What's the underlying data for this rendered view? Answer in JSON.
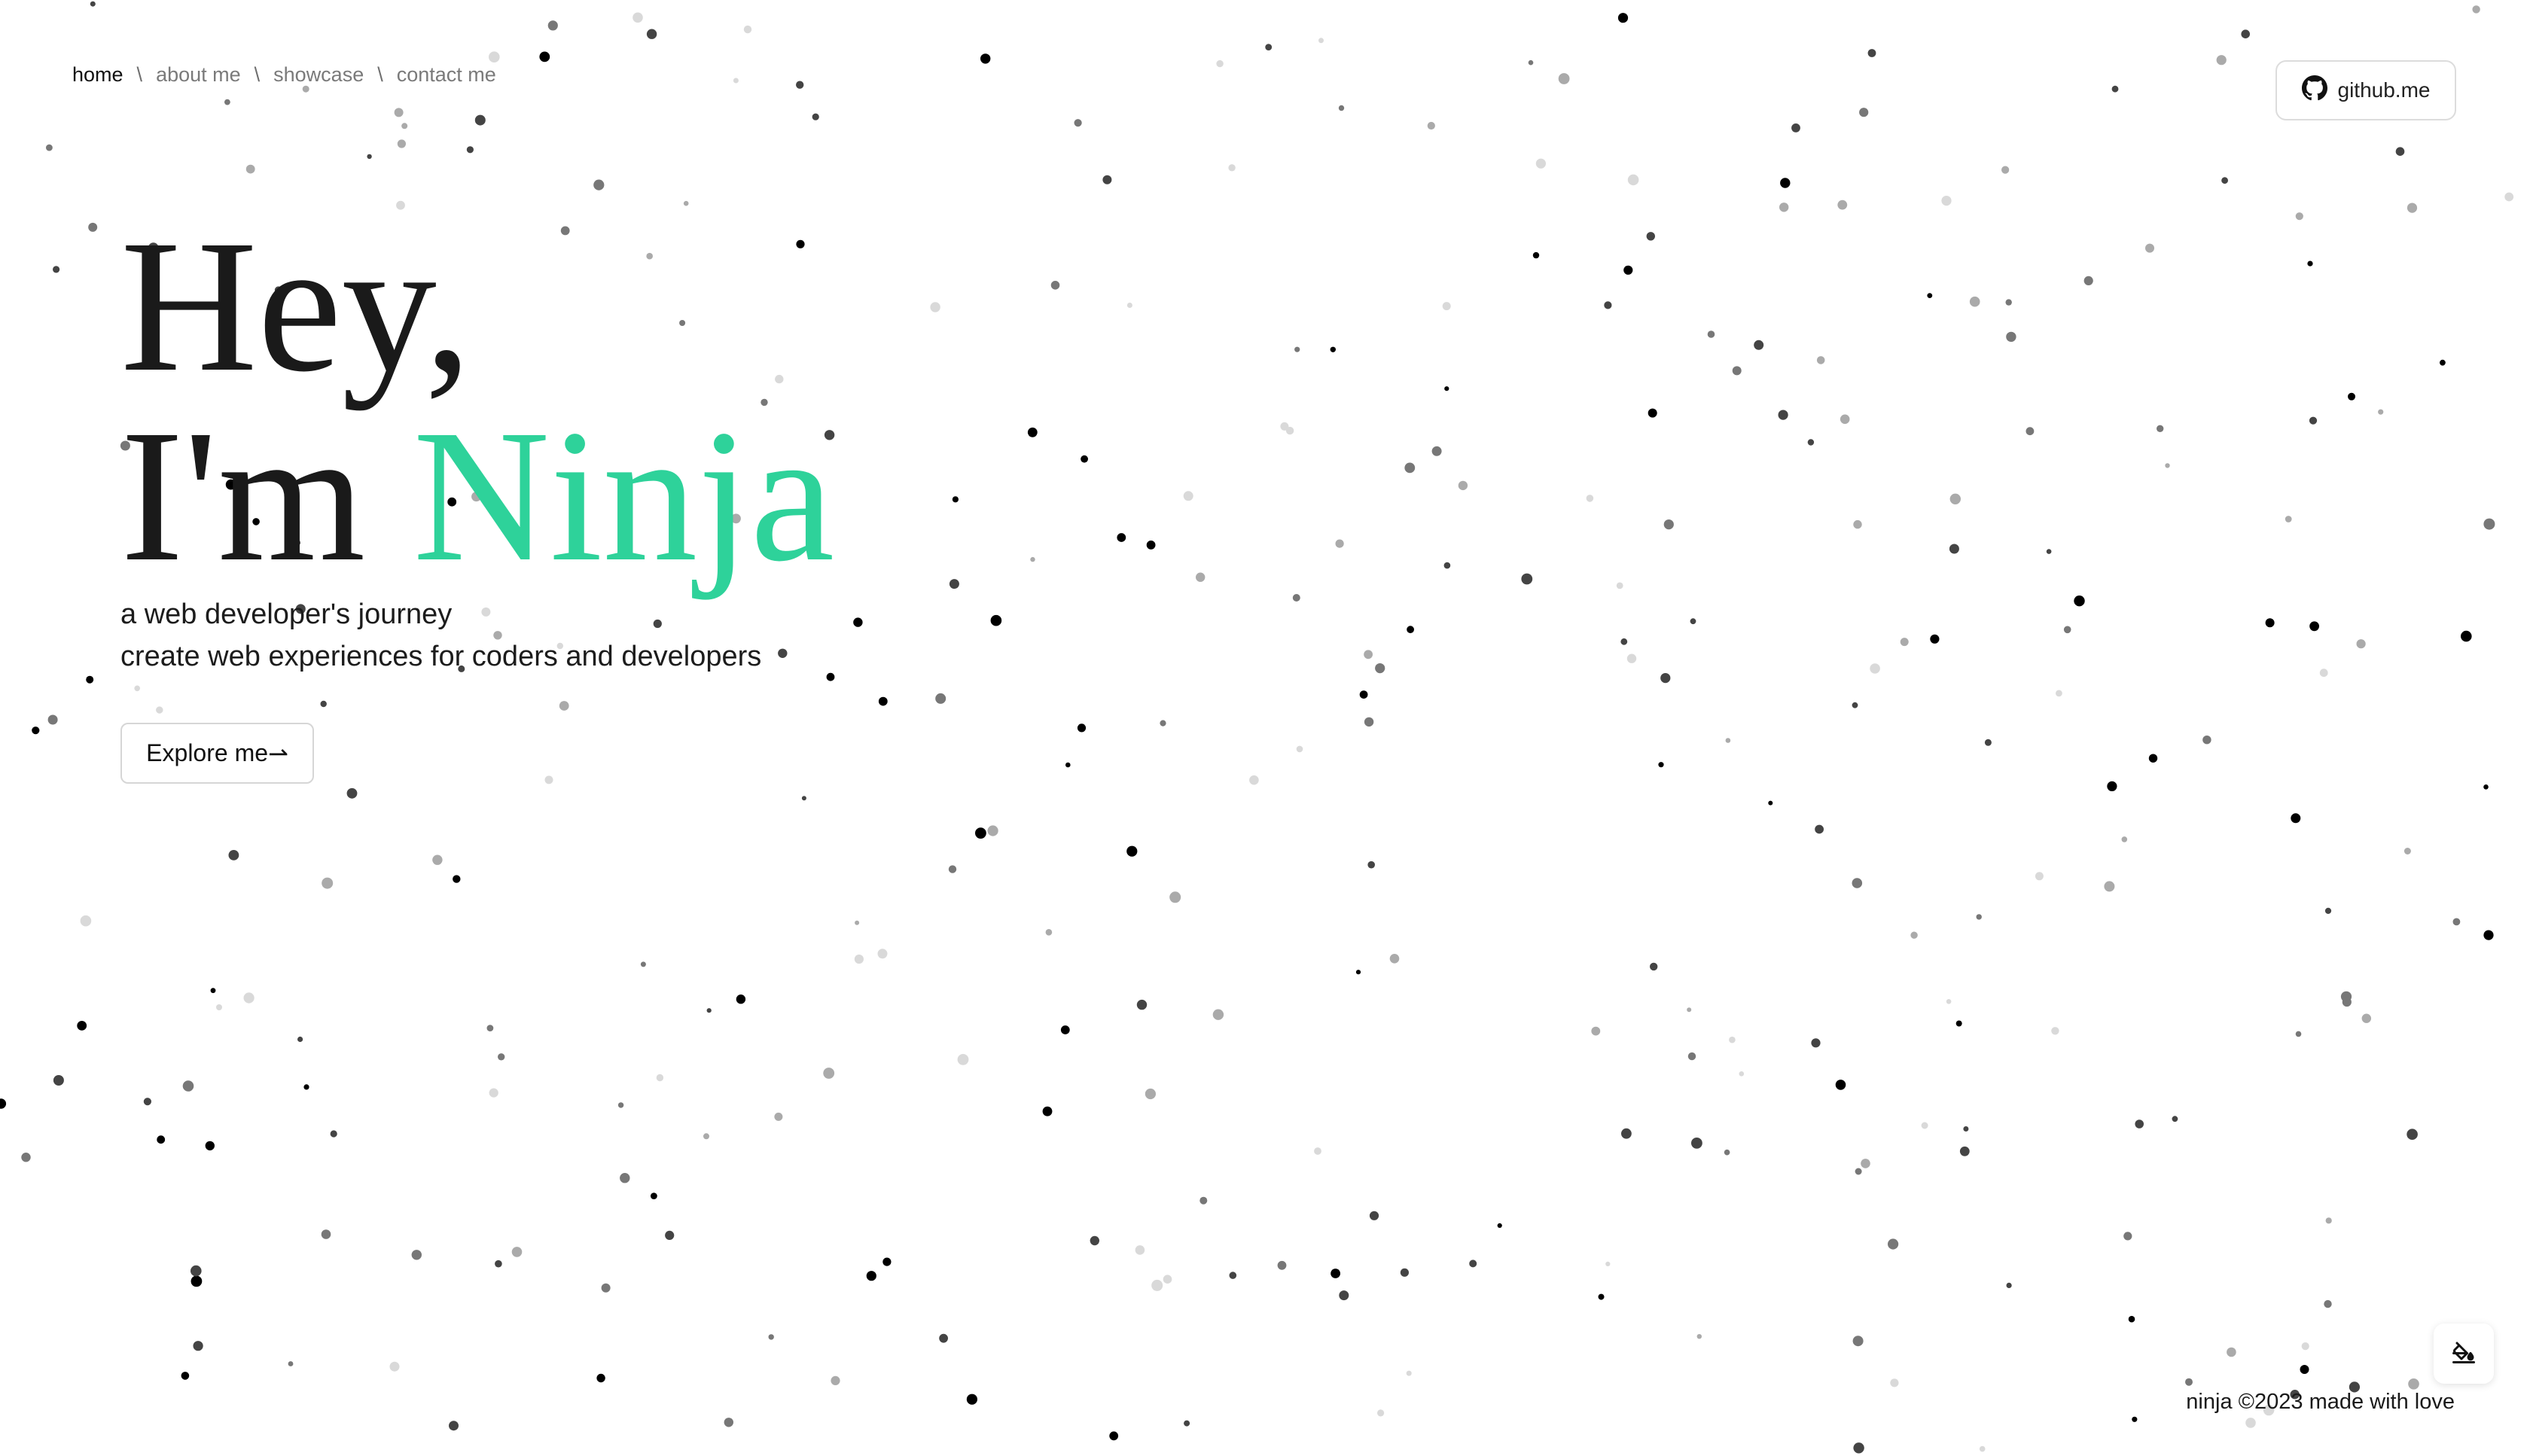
{
  "nav": {
    "items": [
      {
        "label": "home",
        "active": true
      },
      {
        "label": "about me",
        "active": false
      },
      {
        "label": "showcase",
        "active": false
      },
      {
        "label": "contact me",
        "active": false
      }
    ],
    "separator": "\\"
  },
  "github": {
    "label": "github.me",
    "icon": "github-icon"
  },
  "hero": {
    "line1": "Hey,",
    "line2_prefix": "I'm ",
    "name": "Ninja",
    "subtitle1": "a web developer's journey",
    "subtitle2": "create web experiences for coders and developers",
    "accent_color": "#2ed29a"
  },
  "explore": {
    "label": "Explore me",
    "arrow": "⇀"
  },
  "theme_toggle": {
    "icon": "paint-bucket-icon"
  },
  "footer": {
    "text": "ninja ©2023 made with love"
  },
  "background": {
    "pattern": "scattered particle dots",
    "dot_colors": [
      "#000000",
      "#444444",
      "#777777",
      "#aaaaaa",
      "#d9d9d9"
    ]
  }
}
